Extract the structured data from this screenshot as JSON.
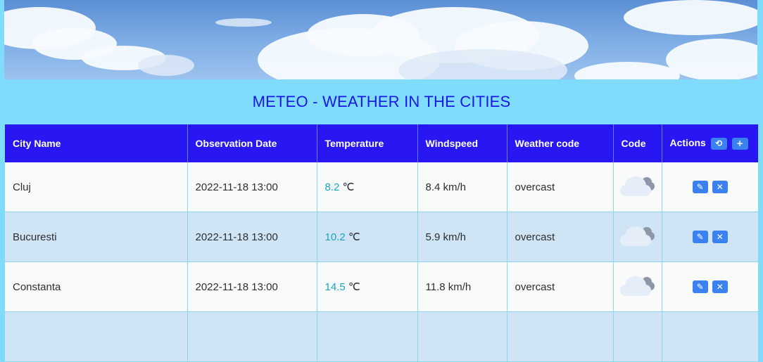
{
  "page": {
    "title": "METEO - WEATHER IN THE CITIES"
  },
  "table": {
    "headers": [
      "City Name",
      "Observation Date",
      "Temperature",
      "Windspeed",
      "Weather code",
      "Code",
      "Actions"
    ],
    "refresh_icon": "refresh-icon",
    "add_icon": "plus-icon",
    "rows": [
      {
        "city": "Cluj",
        "date": "2022-11-18 13:00",
        "temp": "8.2",
        "unit": "℃",
        "wind": "8.4 km/h",
        "weather": "overcast",
        "code_icon": "overcast-cloud-icon"
      },
      {
        "city": "Bucuresti",
        "date": "2022-11-18 13:00",
        "temp": "10.2",
        "unit": "℃",
        "wind": "5.9 km/h",
        "weather": "overcast",
        "code_icon": "overcast-cloud-icon"
      },
      {
        "city": "Constanta",
        "date": "2022-11-18 13:00",
        "temp": "14.5",
        "unit": "℃",
        "wind": "11.8 km/h",
        "weather": "overcast",
        "code_icon": "overcast-cloud-icon"
      }
    ]
  },
  "colors": {
    "background": "#80dcfd",
    "header": "#2817f3",
    "title": "#1717e6",
    "button": "#3b82f0",
    "temperature": "#1aa3c0"
  }
}
